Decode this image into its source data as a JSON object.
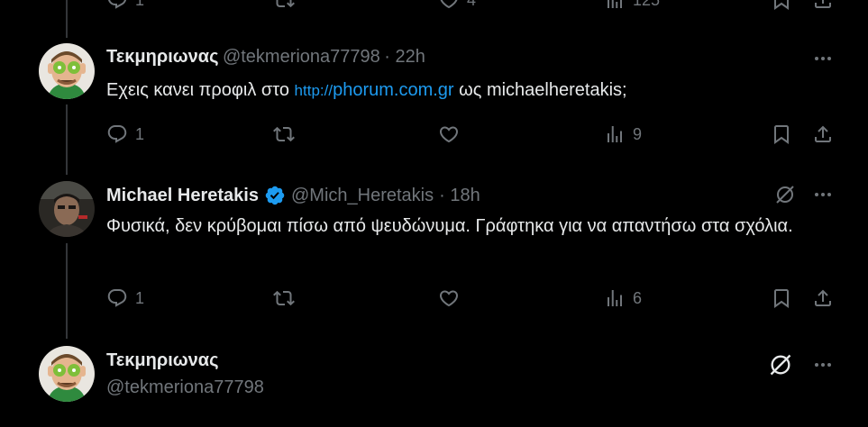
{
  "top_partial": {
    "views": "125",
    "likes": "4",
    "replies": "1"
  },
  "tweets": [
    {
      "name": "Τεκμηριωνας",
      "handle": "@tekmeriona77798",
      "time": "· 22h",
      "text_before": "Εχεις κανει προφιλ στο ",
      "link_proto": "http://",
      "link_main": "phorum.com.gr",
      "text_after": " ως michaelheretakis;",
      "replies": "1",
      "views": "9"
    },
    {
      "name": "Michael Heretakis",
      "handle": "@Mich_Heretakis",
      "time": "· 18h",
      "text": "Φυσικά, δεν κρύβομαι πίσω από ψευδώνυμα. Γράφτηκα για να απαντήσω στα σχόλια.",
      "replies": "1",
      "views": "6"
    },
    {
      "name": "Τεκμηριωνας",
      "handle": "@tekmeriona77798"
    }
  ],
  "colors": {
    "accent": "#1d9bf0",
    "muted": "#71767b",
    "text": "#e7e9ea",
    "background": "#000000"
  }
}
